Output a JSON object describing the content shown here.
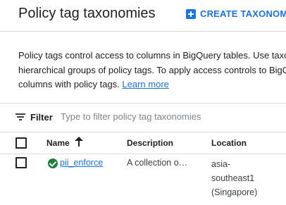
{
  "header": {
    "title": "Policy tag taxonomies",
    "create_button_label": "CREATE TAXONOMY",
    "create_icon": "add-box-icon",
    "accent_color": "#1a73e8"
  },
  "description": {
    "line1": "Policy tags control access to columns in BigQuery tables. Use taxo",
    "line2": "hierarchical groups of policy tags. To apply access controls to BigQ",
    "line3": "columns with policy tags.",
    "learn_more": "Learn more"
  },
  "filter": {
    "label": "Filter",
    "placeholder": "Type to filter policy tag taxonomies",
    "icon": "filter-list-icon"
  },
  "table": {
    "columns": {
      "name": "Name",
      "description": "Description",
      "location": "Location"
    },
    "sort_icon": "arrow-upward-icon",
    "rows": [
      {
        "status": "enforced",
        "status_icon": "check-circle-icon",
        "status_color": "#188038",
        "name": "pii_enforce",
        "description": "A collection o…",
        "location_lines": [
          "asia-",
          "southeast1",
          "(Singapore)"
        ]
      }
    ]
  }
}
